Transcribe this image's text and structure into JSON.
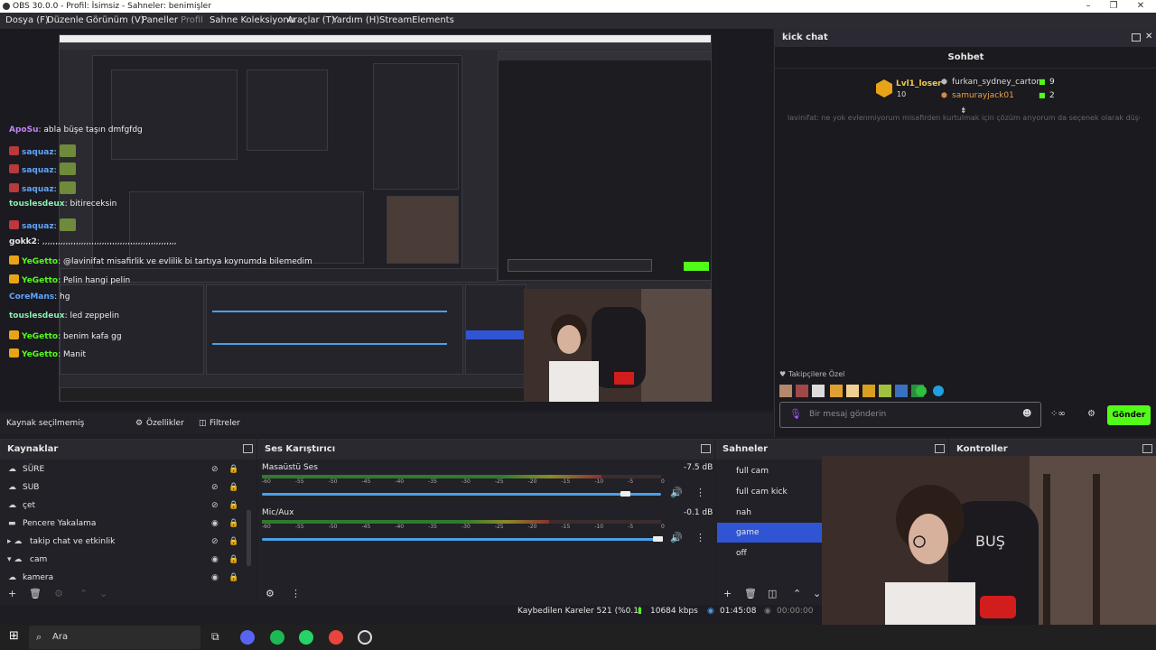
{
  "window": {
    "title": "OBS 30.0.0 - Profil: İsimsiz - Sahneler: benimişler"
  },
  "menu": [
    "Dosya (F)",
    "Düzenle",
    "Görünüm (V)",
    "Paneller",
    "Profil",
    "Sahne Koleksiyonu",
    "Araçlar (T)",
    "Yardım (H)",
    "StreamElements"
  ],
  "chat": {
    "dock_title": "kick chat",
    "tab": "Sohbet",
    "leaders": {
      "first": {
        "name": "Lvl1_loser",
        "count": "10"
      },
      "second": {
        "name": "furkan_sydney_carton",
        "count": "9"
      },
      "third": {
        "name": "samurayjack01",
        "count": "2"
      }
    },
    "pinned_fragment": "lavinifat: ne yok evlenmiyorum misafirden kurtulmak için çözüm arıyorum da seçenek olarak düşün...",
    "messages": [
      {
        "user": "ApoSu",
        "text": "abla büşe taşın dmfgfdg",
        "color": "#c084fc"
      },
      {
        "user": "saquaz",
        "text": "",
        "color": "#60a5fa",
        "emote": true
      },
      {
        "user": "saquaz",
        "text": "",
        "color": "#60a5fa",
        "emote": true
      },
      {
        "user": "saquaz",
        "text": "",
        "color": "#60a5fa",
        "emote": true
      },
      {
        "user": "touslesdeux",
        "text": "bitireceksin",
        "color": "#86efac"
      },
      {
        "user": "saquaz",
        "text": "",
        "color": "#60a5fa",
        "emote": true
      },
      {
        "user": "gokk2",
        "text": ",,,,,,,,,,,,,,,,,,,,,,,,,,,,,,,,,,,,,,,,,,,,,,,,,,,,",
        "color": "#e6e6e6"
      },
      {
        "user": "YeGetto",
        "text": "@lavinifat misafirlik ve evlilik bi tartıya koynumda bilemedim",
        "color": "#53fc18"
      },
      {
        "user": "YeGetto",
        "text": "Pelin hangi pelin",
        "color": "#53fc18"
      },
      {
        "user": "CoreMans",
        "text": "hg",
        "color": "#60a5fa"
      },
      {
        "user": "touslesdeux",
        "text": "led zeppelin",
        "color": "#86efac"
      },
      {
        "user": "YeGetto",
        "text": "benim kafa gg",
        "color": "#53fc18"
      },
      {
        "user": "YeGetto",
        "text": "Manit",
        "color": "#53fc18"
      }
    ],
    "follower_label": "Takipçilere Özel",
    "input_placeholder": "Bir mesaj gönderin",
    "send_label": "Gönder"
  },
  "source_bar": {
    "none_selected": "Kaynak seçilmemiş",
    "properties": "Özellikler",
    "filters": "Filtreler"
  },
  "sources": {
    "title": "Kaynaklar",
    "items": [
      {
        "label": "SÜRE",
        "visible": false
      },
      {
        "label": "SUB",
        "visible": false
      },
      {
        "label": "çet",
        "visible": false
      },
      {
        "label": "Pencere Yakalama",
        "visible": true
      },
      {
        "label": "takip chat ve etkinlik",
        "visible": false
      },
      {
        "label": "cam",
        "visible": true
      },
      {
        "label": "kamera",
        "visible": true
      }
    ]
  },
  "mixer": {
    "title": "Ses Karıştırıcı",
    "channels": [
      {
        "name": "Masaüstü Ses",
        "db": "-7.5 dB",
        "level": 0.85,
        "volume": 0.91
      },
      {
        "name": "Mic/Aux",
        "db": "-0.1 dB",
        "level": 0.72,
        "volume": 0.99
      }
    ],
    "scale": [
      "-60",
      "-55",
      "-50",
      "-45",
      "-40",
      "-35",
      "-30",
      "-25",
      "-20",
      "-15",
      "-10",
      "-5",
      "0"
    ]
  },
  "scenes": {
    "title": "Sahneler",
    "items": [
      "full cam",
      "full cam kick",
      "nah",
      "game",
      "off"
    ],
    "selected": "game"
  },
  "controls": {
    "title": "Kontroller"
  },
  "status": {
    "dropped": "Kaybedilen Kareler 521 (%0.1)",
    "bitrate": "10684 kbps",
    "time1": "01:45:08",
    "time2": "00:00:00"
  },
  "taskbar": {
    "search_placeholder": "Ara"
  },
  "colors": {
    "accent": "#53fc18",
    "selection": "#2f55d4",
    "slider": "#4aa0e8"
  }
}
